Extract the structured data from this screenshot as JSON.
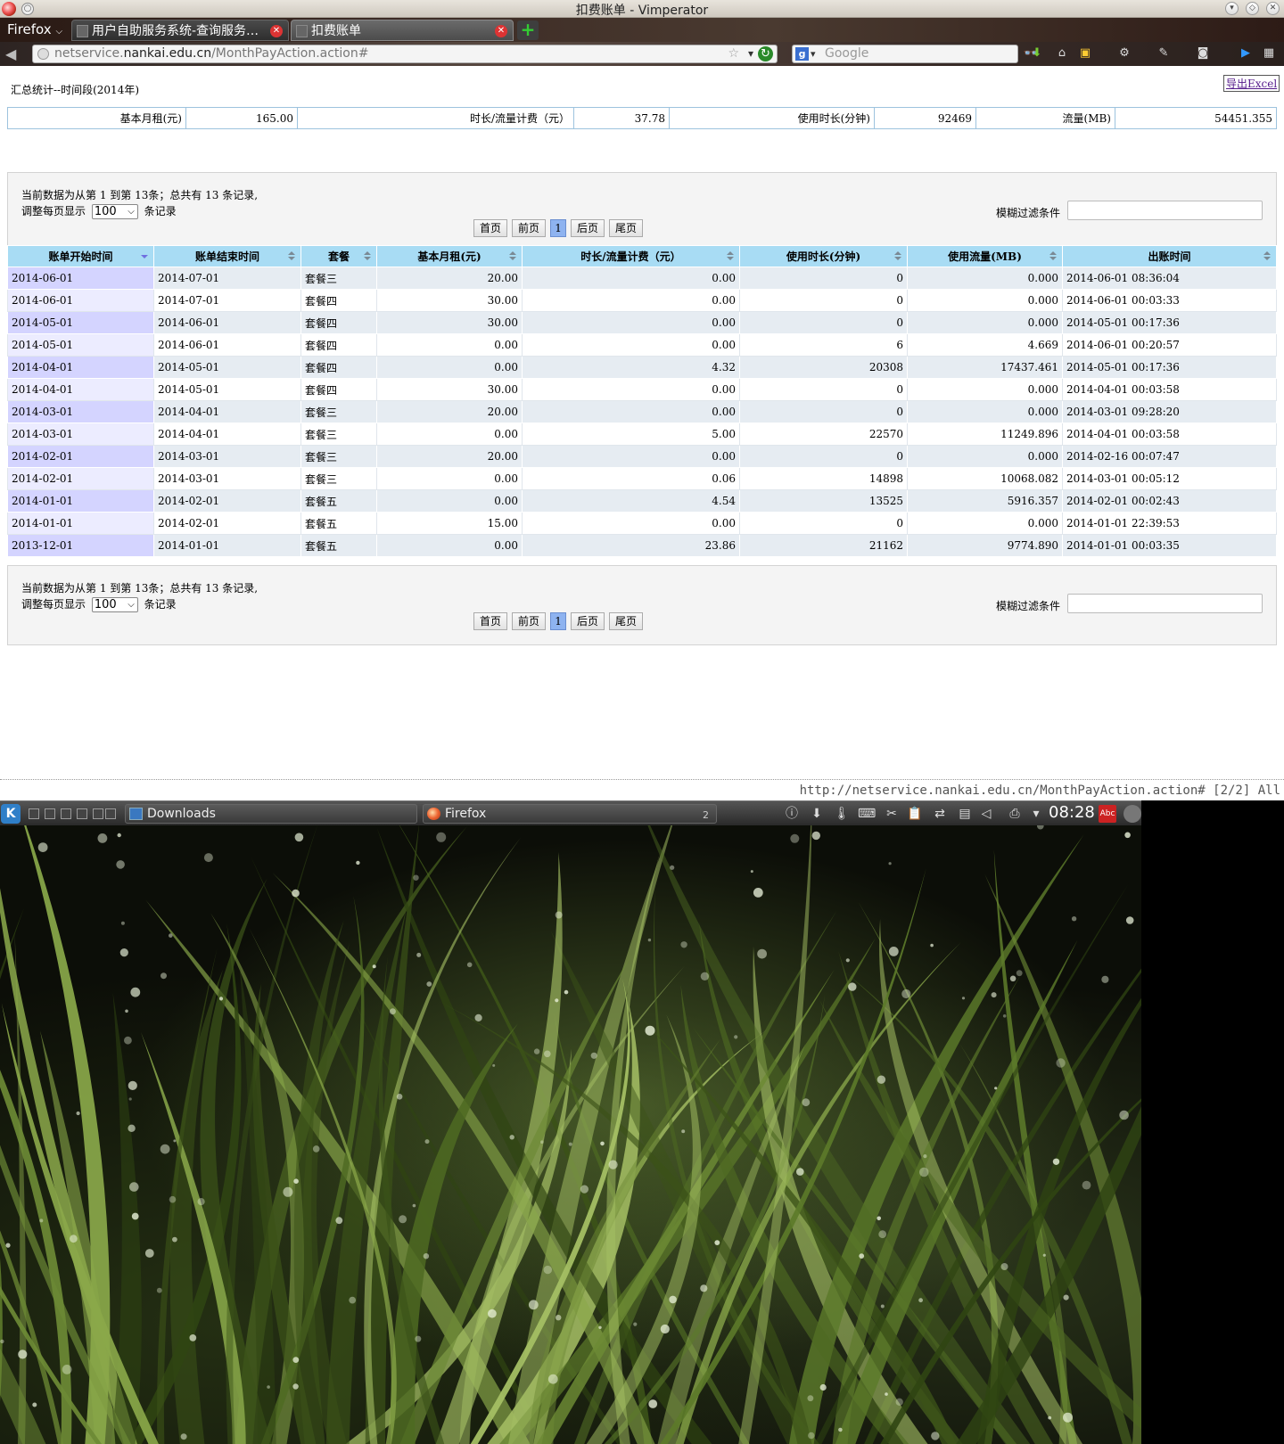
{
  "window": {
    "title": "扣费账单 - Vimperator",
    "menu_icon": "○"
  },
  "tabs": {
    "firefox_menu": "Firefox",
    "items": [
      {
        "label": "用户自助服务系统-查询服务…"
      },
      {
        "label": "扣费账单"
      }
    ],
    "new_tab": "+"
  },
  "navbar": {
    "url_prefix": "netservice.",
    "url_host": "nankai.edu.cn",
    "url_path": "/MonthPayAction.action#",
    "search_placeholder": "Google"
  },
  "page": {
    "summary_title": "汇总统计--时间段(2014年)",
    "export_label": "导出Excel",
    "summary": [
      {
        "label": "基本月租(元)",
        "value": "165.00"
      },
      {
        "label": "时长/流量计费（元）",
        "value": "37.78"
      },
      {
        "label": "使用时长(分钟)",
        "value": "92469"
      },
      {
        "label": "流量(MB)",
        "value": "54451.355"
      }
    ],
    "info_text": "当前数据为从第 1 到第 13条；总共有 13 条记录,",
    "perpage_prefix": "调整每页显示",
    "perpage_value": "100",
    "perpage_suffix": "条记录",
    "filter_label": "模糊过滤条件",
    "pager": {
      "first": "首页",
      "prev": "前页",
      "current": "1",
      "next": "后页",
      "last": "尾页"
    },
    "columns": [
      "账单开始时间",
      "账单结束时间",
      "套餐",
      "基本月租(元)",
      "时长/流量计费（元）",
      "使用时长(分钟)",
      "使用流量(MB)",
      "出账时间"
    ],
    "rows": [
      [
        "2014-06-01",
        "2014-07-01",
        "套餐三",
        "20.00",
        "0.00",
        "0",
        "0.000",
        "2014-06-01 08:36:04"
      ],
      [
        "2014-06-01",
        "2014-07-01",
        "套餐四",
        "30.00",
        "0.00",
        "0",
        "0.000",
        "2014-06-01 00:03:33"
      ],
      [
        "2014-05-01",
        "2014-06-01",
        "套餐四",
        "30.00",
        "0.00",
        "0",
        "0.000",
        "2014-05-01 00:17:36"
      ],
      [
        "2014-05-01",
        "2014-06-01",
        "套餐四",
        "0.00",
        "0.00",
        "6",
        "4.669",
        "2014-06-01 00:20:57"
      ],
      [
        "2014-04-01",
        "2014-05-01",
        "套餐四",
        "0.00",
        "4.32",
        "20308",
        "17437.461",
        "2014-05-01 00:17:36"
      ],
      [
        "2014-04-01",
        "2014-05-01",
        "套餐四",
        "30.00",
        "0.00",
        "0",
        "0.000",
        "2014-04-01 00:03:58"
      ],
      [
        "2014-03-01",
        "2014-04-01",
        "套餐三",
        "20.00",
        "0.00",
        "0",
        "0.000",
        "2014-03-01 09:28:20"
      ],
      [
        "2014-03-01",
        "2014-04-01",
        "套餐三",
        "0.00",
        "5.00",
        "22570",
        "11249.896",
        "2014-04-01 00:03:58"
      ],
      [
        "2014-02-01",
        "2014-03-01",
        "套餐三",
        "20.00",
        "0.00",
        "0",
        "0.000",
        "2014-02-16 00:07:47"
      ],
      [
        "2014-02-01",
        "2014-03-01",
        "套餐三",
        "0.00",
        "0.06",
        "14898",
        "10068.082",
        "2014-03-01 00:05:12"
      ],
      [
        "2014-01-01",
        "2014-02-01",
        "套餐五",
        "0.00",
        "4.54",
        "13525",
        "5916.357",
        "2014-02-01 00:02:43"
      ],
      [
        "2014-01-01",
        "2014-02-01",
        "套餐五",
        "15.00",
        "0.00",
        "0",
        "0.000",
        "2014-01-01 22:39:53"
      ],
      [
        "2013-12-01",
        "2014-01-01",
        "套餐五",
        "0.00",
        "23.86",
        "21162",
        "9774.890",
        "2014-01-01 00:03:35"
      ]
    ]
  },
  "statusline": "http://netservice.nankai.edu.cn/MonthPayAction.action# [2/2] All",
  "taskbar": {
    "tasks": [
      {
        "label": "Downloads"
      },
      {
        "label": "Firefox",
        "badge": "2"
      }
    ],
    "clock": "08:28"
  }
}
